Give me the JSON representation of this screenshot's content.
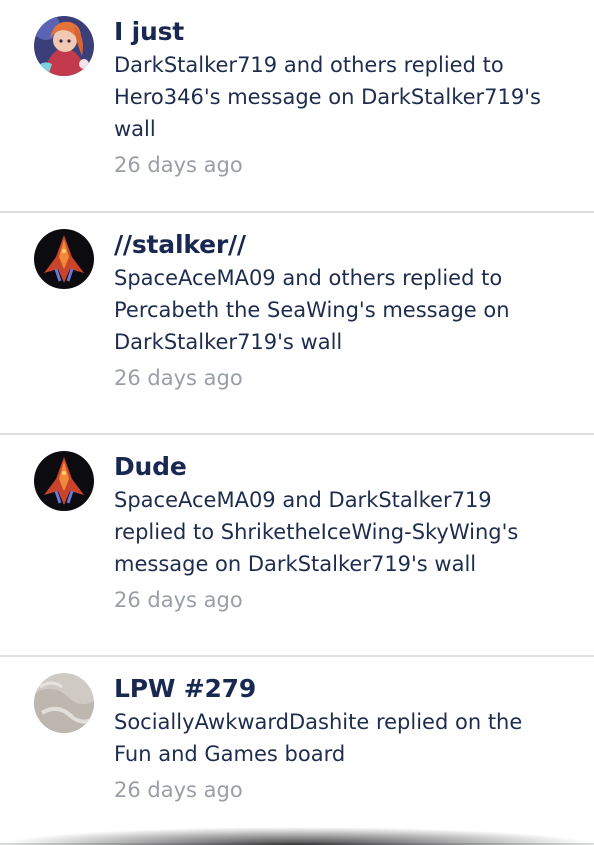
{
  "notifications": [
    {
      "title": "I just",
      "message": "DarkStalker719 and others replied to Hero346's message on DarkStalker719's wall",
      "time": "26 days ago",
      "avatar_icon": "anime-character-avatar"
    },
    {
      "title": "//stalker//",
      "message": "SpaceAceMA09 and others replied to Percabeth the SeaWing's message on DarkStalker719's wall",
      "time": "26 days ago",
      "avatar_icon": "dragon-avatar"
    },
    {
      "title": "Dude",
      "message": "SpaceAceMA09 and DarkStalker719 replied to ShriketheIceWing-SkyWing's message on DarkStalker719's wall",
      "time": "26 days ago",
      "avatar_icon": "dragon-avatar"
    },
    {
      "title": "LPW #279",
      "message": "SociallyAwkwardDashite replied on the Fun and Games board",
      "time": "26 days ago",
      "avatar_icon": "default-gray-avatar"
    }
  ],
  "colors": {
    "title": "#182850",
    "message": "#1e2c4e",
    "time": "#9a9ea6",
    "divider": "#dcdde1"
  }
}
